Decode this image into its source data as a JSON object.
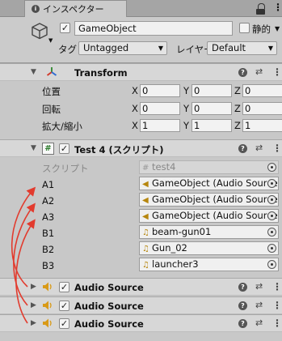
{
  "tab": {
    "label": "インスペクター",
    "icon": "info-icon"
  },
  "gameobject": {
    "active_check": "✓",
    "name": "GameObject",
    "static_label": "静的",
    "tag_label": "タグ",
    "tag_value": "Untagged",
    "layer_label": "レイヤー",
    "layer_value": "Default"
  },
  "transform": {
    "title": "Transform",
    "rows": [
      {
        "label": "位置",
        "x": "0",
        "y": "0",
        "z": "0"
      },
      {
        "label": "回転",
        "x": "0",
        "y": "0",
        "z": "0"
      },
      {
        "label": "拡大/縮小",
        "x": "1",
        "y": "1",
        "z": "1"
      }
    ],
    "axes": {
      "x": "X",
      "y": "Y",
      "z": "Z"
    }
  },
  "script_component": {
    "title": "Test 4 (スクリプト)",
    "check": "✓",
    "script_label": "スクリプト",
    "script_value": "test4",
    "fields": [
      {
        "label": "A1",
        "value": "GameObject (Audio Source",
        "icon": "audio-source-icon"
      },
      {
        "label": "A2",
        "value": "GameObject (Audio Source",
        "icon": "audio-source-icon"
      },
      {
        "label": "A3",
        "value": "GameObject (Audio Source",
        "icon": "audio-source-icon"
      },
      {
        "label": "B1",
        "value": "beam-gun01",
        "icon": "audio-clip-icon"
      },
      {
        "label": "B2",
        "value": "Gun_02",
        "icon": "audio-clip-icon"
      },
      {
        "label": "B3",
        "value": "launcher3",
        "icon": "audio-clip-icon"
      }
    ]
  },
  "audio_sources": [
    {
      "title": "Audio Source",
      "check": "✓"
    },
    {
      "title": "Audio Source",
      "check": "✓"
    },
    {
      "title": "Audio Source",
      "check": "✓"
    }
  ],
  "colors": {
    "arrow": "#e23b2e",
    "audio_icon": "#d99a17"
  }
}
